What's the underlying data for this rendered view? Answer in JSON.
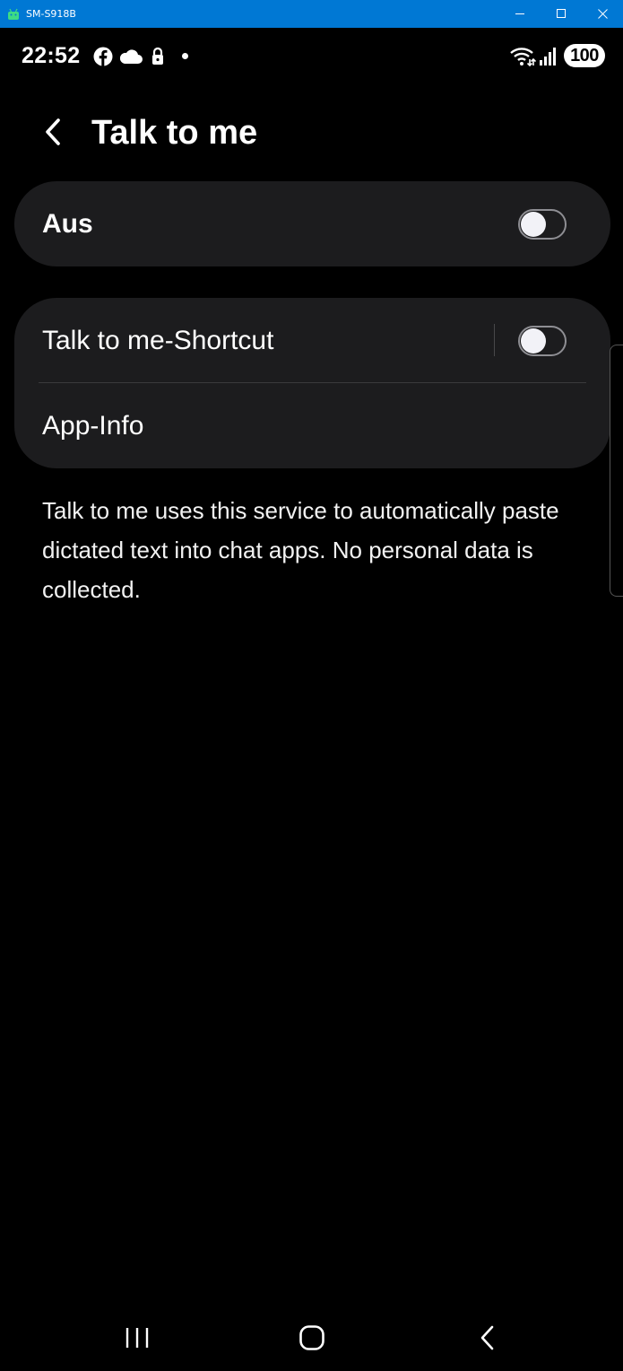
{
  "window": {
    "title": "SM-S918B"
  },
  "status_bar": {
    "time": "22:52",
    "battery": "100",
    "icons": [
      "facebook-icon",
      "cloud-icon",
      "lock-icon",
      "dot-icon",
      "wifi-icon",
      "signal-icon",
      "battery-icon"
    ]
  },
  "header": {
    "title": "Talk to me",
    "back_icon": "back-arrow-icon"
  },
  "main_switch": {
    "label": "Aus",
    "enabled": false
  },
  "options": {
    "shortcut_label": "Talk to me-Shortcut",
    "shortcut_enabled": false,
    "app_info_label": "App-Info"
  },
  "description": "Talk to me uses this service to automatically paste dictated text into chat apps. No personal data is collected.",
  "nav": {
    "recents_icon": "recents-icon",
    "home_icon": "home-icon",
    "back_icon": "nav-back-icon"
  },
  "colors": {
    "titlebar": "#0078d4",
    "background": "#000000",
    "card": "#1c1c1e",
    "text": "#ffffff"
  }
}
